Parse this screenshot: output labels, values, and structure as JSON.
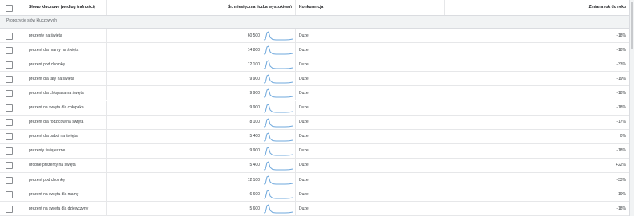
{
  "header": {
    "keyword": "Słowo kluczowe (według trafności)",
    "avg_monthly": "Śr. miesięczna liczba wyszukiwań",
    "competition": "Konkurencja",
    "yoy": "Zmiana rok do roku"
  },
  "group_label": "Propozycje słów kluczowych",
  "rows": [
    {
      "keyword": "prezenty na święta",
      "volume": "60 500",
      "competition": "Duże",
      "yoy": "-18%"
    },
    {
      "keyword": "prezent dla mamy na święta",
      "volume": "14 800",
      "competition": "Duże",
      "yoy": "-18%"
    },
    {
      "keyword": "prezent pod choinkę",
      "volume": "12 100",
      "competition": "Duże",
      "yoy": "-33%"
    },
    {
      "keyword": "prezent dla taty na święta",
      "volume": "9 900",
      "competition": "Duże",
      "yoy": "-19%"
    },
    {
      "keyword": "prezent dla chłopaka na święta",
      "volume": "9 900",
      "competition": "Duże",
      "yoy": "-18%"
    },
    {
      "keyword": "prezent na święta dla chłopaka",
      "volume": "9 900",
      "competition": "Duże",
      "yoy": "-18%"
    },
    {
      "keyword": "prezent dla rodziców na święta",
      "volume": "8 100",
      "competition": "Duże",
      "yoy": "-17%"
    },
    {
      "keyword": "prezent dla babci na święta",
      "volume": "5 400",
      "competition": "Duże",
      "yoy": "0%"
    },
    {
      "keyword": "prezenty świąteczne",
      "volume": "9 900",
      "competition": "Duże",
      "yoy": "-18%"
    },
    {
      "keyword": "drobne prezenty na święta",
      "volume": "5 400",
      "competition": "Duże",
      "yoy": "+22%"
    },
    {
      "keyword": "prezent pod choinkę",
      "volume": "12 100",
      "competition": "Duże",
      "yoy": "-33%"
    },
    {
      "keyword": "prezent na święta dla mamy",
      "volume": "6 600",
      "competition": "Duże",
      "yoy": "-19%"
    },
    {
      "keyword": "prezent na święta dla dziewczyny",
      "volume": "5 600",
      "competition": "Duże",
      "yoy": "-18%"
    }
  ],
  "colors": {
    "trend_line": "#6fa8dc",
    "group_bg": "#f1f3f4",
    "grid": "#e6e7e9"
  }
}
